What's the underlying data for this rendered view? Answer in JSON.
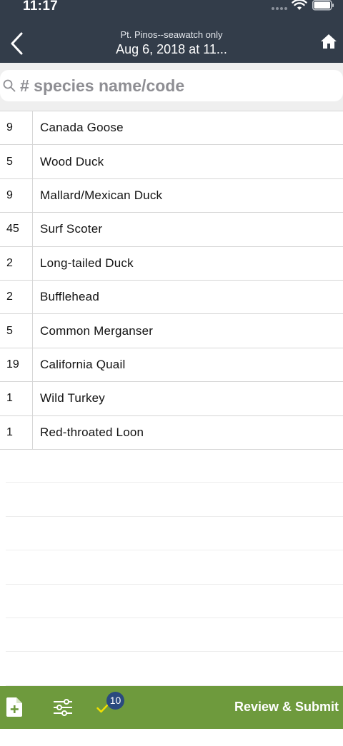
{
  "status": {
    "time": "11:17"
  },
  "header": {
    "subtitle": "Pt. Pinos--seawatch only",
    "title": "Aug 6, 2018 at 11..."
  },
  "search": {
    "placeholder": "# species name/code"
  },
  "species": [
    {
      "count": "9",
      "name": "Canada Goose"
    },
    {
      "count": "5",
      "name": "Wood Duck"
    },
    {
      "count": "9",
      "name": "Mallard/Mexican Duck"
    },
    {
      "count": "45",
      "name": "Surf Scoter"
    },
    {
      "count": "2",
      "name": "Long-tailed Duck"
    },
    {
      "count": "2",
      "name": "Bufflehead"
    },
    {
      "count": "5",
      "name": "Common Merganser"
    },
    {
      "count": "19",
      "name": "California Quail"
    },
    {
      "count": "1",
      "name": "Wild Turkey"
    },
    {
      "count": "1",
      "name": "Red-throated Loon"
    }
  ],
  "toolbar": {
    "badge_count": "10",
    "review_label": "Review & Submit"
  },
  "colors": {
    "header_bg": "#333d4a",
    "toolbar_bg": "#6e9a3d",
    "badge_bg": "#2a4a7f",
    "check_color": "#f2e000"
  },
  "icons": [
    "back-icon",
    "home-icon",
    "search-icon",
    "add-checklist-icon",
    "filter-icon",
    "check-icon",
    "wifi-icon",
    "battery-icon"
  ]
}
